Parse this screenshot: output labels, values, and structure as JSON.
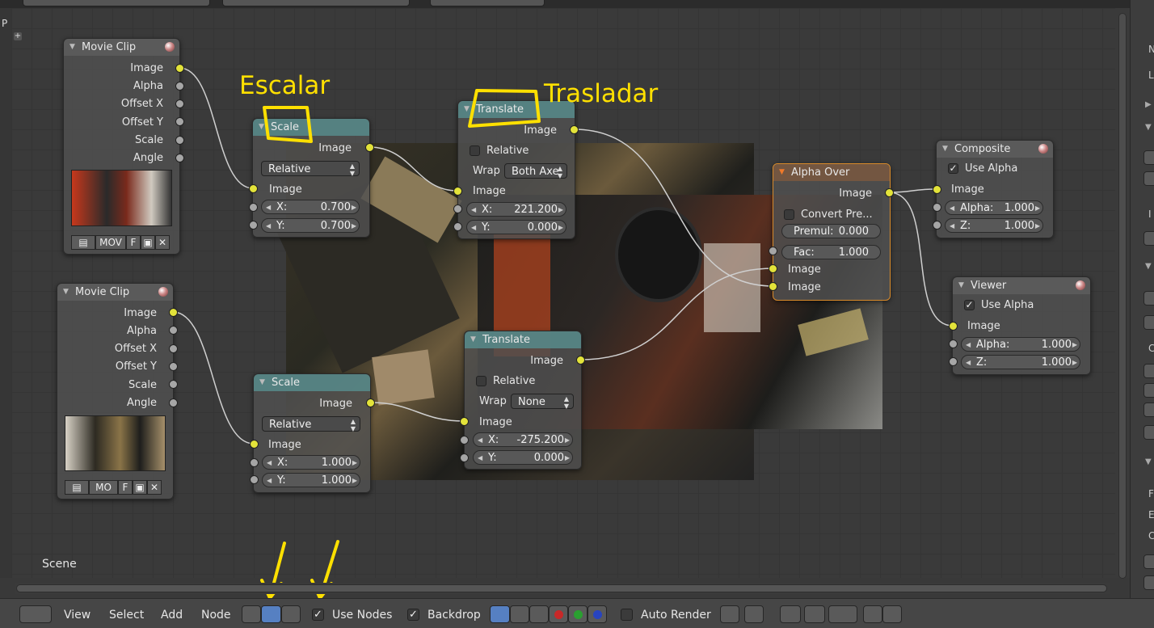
{
  "left_edge_label": "P",
  "annotations": {
    "scale_note": "Escalar",
    "translate_note": "Trasladar"
  },
  "scene_label": "Scene",
  "nodes": {
    "movieclip1": {
      "title": "Movie Clip",
      "outputs": [
        "Image",
        "Alpha",
        "Offset X",
        "Offset Y",
        "Scale",
        "Angle"
      ],
      "clip_name": "MOV",
      "f_label": "F"
    },
    "movieclip2": {
      "title": "Movie Clip",
      "outputs": [
        "Image",
        "Alpha",
        "Offset X",
        "Offset Y",
        "Scale",
        "Angle"
      ],
      "clip_name": "MO",
      "f_label": "F"
    },
    "scale1": {
      "title": "Scale",
      "output": "Image",
      "space": "Relative",
      "input": "Image",
      "x_label": "X:",
      "x_value": "0.700",
      "y_label": "Y:",
      "y_value": "0.700"
    },
    "scale2": {
      "title": "Scale",
      "output": "Image",
      "space": "Relative",
      "input": "Image",
      "x_label": "X:",
      "x_value": "1.000",
      "y_label": "Y:",
      "y_value": "1.000"
    },
    "translate1": {
      "title": "Translate",
      "output": "Image",
      "relative_label": "Relative",
      "relative_checked": false,
      "wrap_label": "Wrap",
      "wrap_value": "Both Axe",
      "input": "Image",
      "x_label": "X:",
      "x_value": "221.200",
      "y_label": "Y:",
      "y_value": "0.000"
    },
    "translate2": {
      "title": "Translate",
      "output": "Image",
      "relative_label": "Relative",
      "relative_checked": false,
      "wrap_label": "Wrap",
      "wrap_value": "None",
      "input": "Image",
      "x_label": "X:",
      "x_value": "-275.200",
      "y_label": "Y:",
      "y_value": "0.000"
    },
    "alphaover": {
      "title": "Alpha Over",
      "output": "Image",
      "convert_label": "Convert Pre...",
      "convert_checked": false,
      "premul_label": "Premul:",
      "premul_value": "0.000",
      "fac_label": "Fac:",
      "fac_value": "1.000",
      "input1": "Image",
      "input2": "Image"
    },
    "composite": {
      "title": "Composite",
      "use_alpha_label": "Use Alpha",
      "use_alpha_checked": true,
      "input": "Image",
      "alpha_label": "Alpha:",
      "alpha_value": "1.000",
      "z_label": "Z:",
      "z_value": "1.000"
    },
    "viewer": {
      "title": "Viewer",
      "use_alpha_label": "Use Alpha",
      "use_alpha_checked": true,
      "input": "Image",
      "alpha_label": "Alpha:",
      "alpha_value": "1.000",
      "z_label": "Z:",
      "z_value": "1.000"
    }
  },
  "header": {
    "menus": [
      "View",
      "Select",
      "Add",
      "Node"
    ],
    "use_nodes_label": "Use Nodes",
    "use_nodes_checked": true,
    "backdrop_label": "Backdrop",
    "backdrop_checked": true,
    "auto_render_label": "Auto Render",
    "auto_render_checked": false
  },
  "right_panel_labels": [
    "N",
    "L",
    "I",
    "C",
    "F",
    "E",
    "C"
  ],
  "colors": {
    "socket_image": "#e3e33a",
    "socket_value": "#a6a6a6",
    "active_node_border": "#d88a2a",
    "annotation": "#ffe000",
    "distort_header": "#578787",
    "selected_button": "#5680c2"
  }
}
